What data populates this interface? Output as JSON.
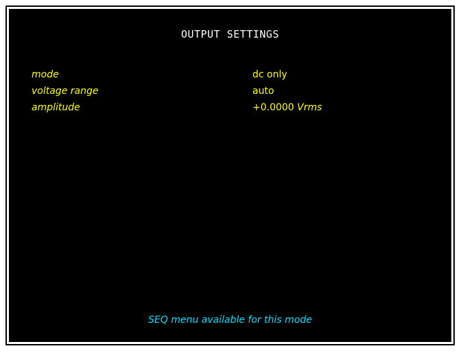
{
  "screen": {
    "title": "OUTPUT SETTINGS",
    "background_color": "#000000",
    "label_color": "#ffff00",
    "status_color": "#00e0ff"
  },
  "settings": [
    {
      "label": "mode",
      "value": "dc only",
      "unit": ""
    },
    {
      "label": "voltage range",
      "value": "auto",
      "unit": ""
    },
    {
      "label": "amplitude",
      "value": "+0.0000",
      "unit": "Vrms"
    }
  ],
  "status": {
    "message": "SEQ menu available for this mode"
  }
}
